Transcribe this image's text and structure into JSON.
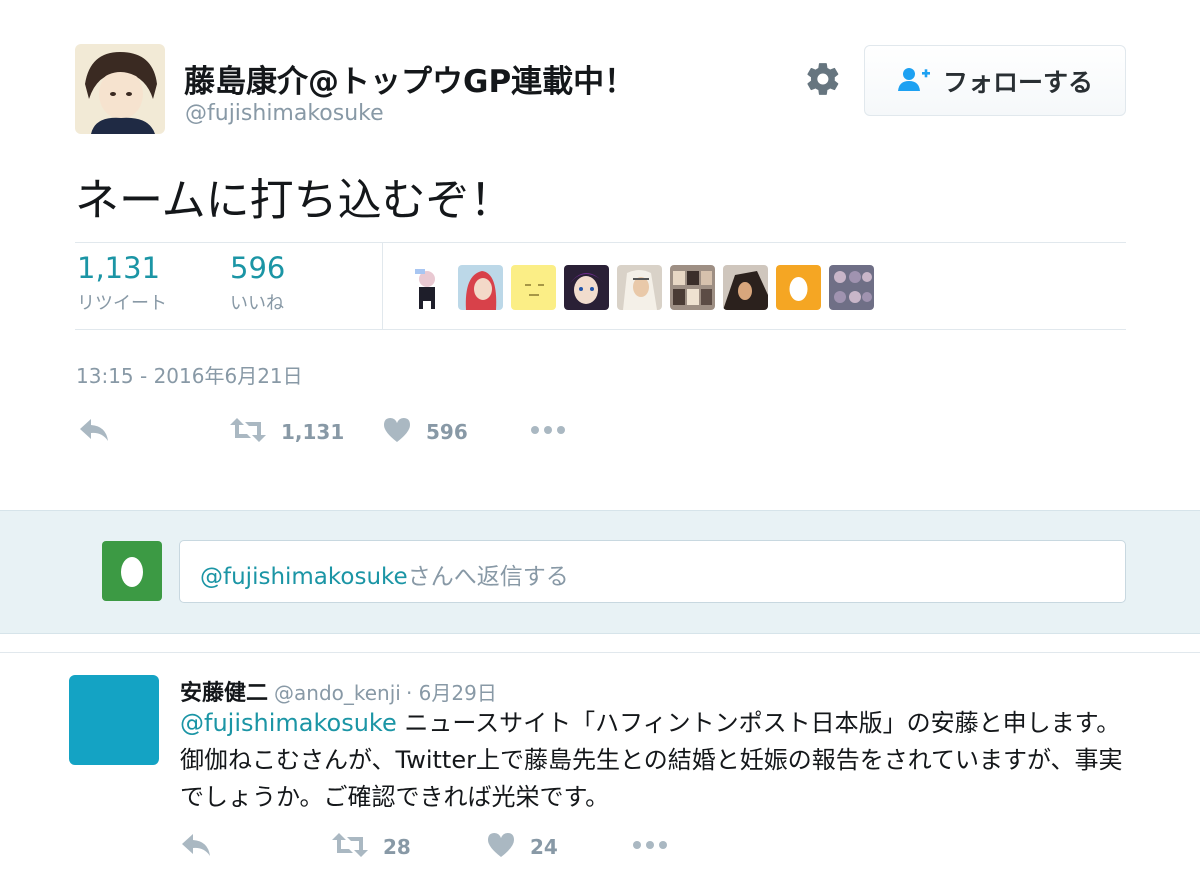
{
  "tweet": {
    "display_name": "藤島康介@トップウGP連載中！",
    "handle": "@fujishimakosuke",
    "follow_label": "フォローする",
    "text": "ネームに打ち込むぞ！",
    "retweets_count": "1,131",
    "retweets_label": "リツイート",
    "likes_count": "596",
    "likes_label": "いいね",
    "timestamp": "13:15 - 2016年6月21日",
    "action_retweet_count": "1,131",
    "action_like_count": "596"
  },
  "reply_box": {
    "mention": "@fujishimakosuke",
    "placeholder_suffix": "さんへ返信する"
  },
  "reply": {
    "name": "安藤健二",
    "handle": "@ando_kenji",
    "date": "· 6月29日",
    "mention": "@fujishimakosuke",
    "text": " ニュースサイト「ハフィントンポスト日本版」の安藤と申します。御伽ねこむさんが、Twitter上で藤島先生との結婚と妊娠の報告をされていますが、事実でしょうか。ご確認できれば光栄です。",
    "retweet_count": "28",
    "like_count": "24"
  },
  "colors": {
    "accent": "#1b95a5",
    "muted": "#8899a6",
    "reply_band": "#e8f2f5",
    "reply_avatar": "#14a3c4",
    "egg_avatar": "#3c9a44"
  }
}
